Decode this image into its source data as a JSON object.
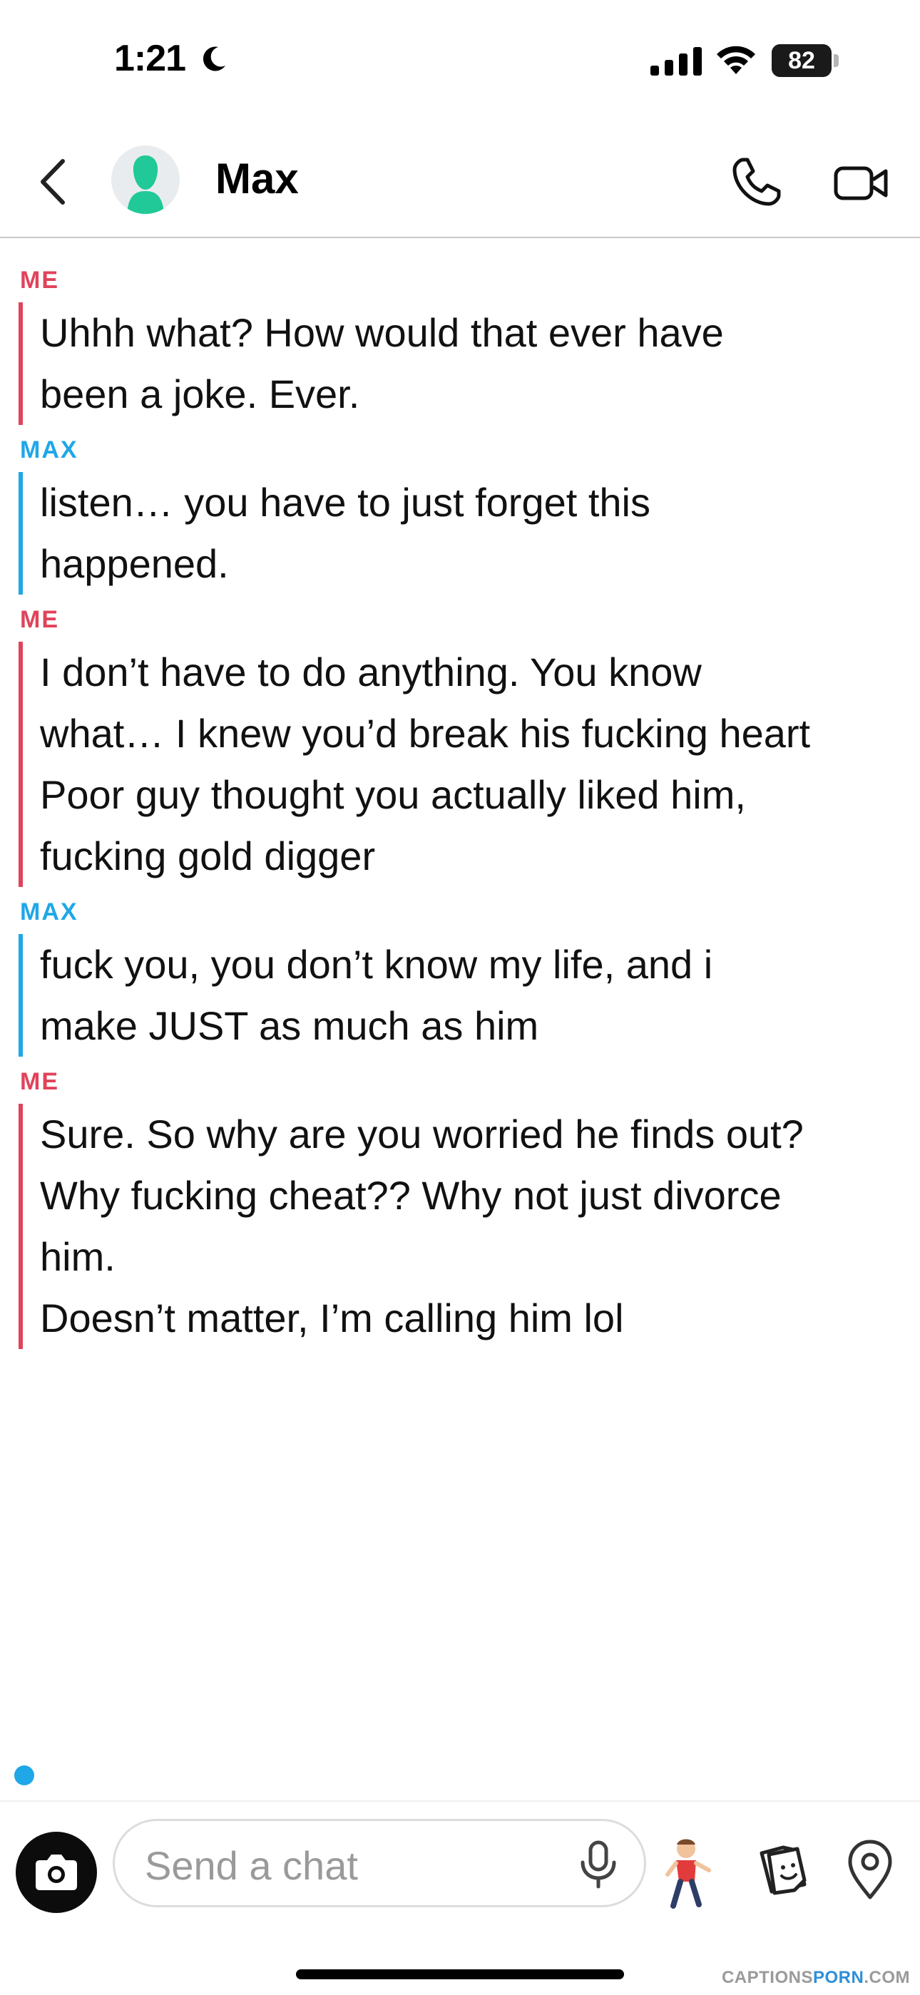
{
  "status_bar": {
    "time": "1:21",
    "battery": "82",
    "battery_level": 0.82
  },
  "header": {
    "contact_name": "Max"
  },
  "messages": [
    {
      "sender": "ME",
      "lines": [
        "Uhhh what? How would that ever have",
        "been a joke. Ever."
      ]
    },
    {
      "sender": "MAX",
      "lines": [
        "listen… you have to just forget this",
        "happened."
      ]
    },
    {
      "sender": "ME",
      "lines": [
        "I don’t have to do anything. You know",
        "what… I knew you’d break his fucking heart",
        "Poor guy thought you actually liked him,",
        "fucking gold digger"
      ]
    },
    {
      "sender": "MAX",
      "lines": [
        "fuck you, you don’t know my life, and i",
        "make JUST as much as him"
      ]
    },
    {
      "sender": "ME",
      "lines": [
        "Sure. So why are you worried he finds out?",
        "Why fucking cheat?? Why not just divorce",
        "him.",
        "Doesn’t matter, I’m calling him lol"
      ]
    }
  ],
  "composer": {
    "placeholder": "Send a chat"
  },
  "watermark": {
    "part1": "CAPTIONS",
    "part2": "PORN",
    "part3": ".COM"
  },
  "colors": {
    "me": "#e0435a",
    "max": "#1fa7e8",
    "avatar": "#20c997"
  },
  "icons": [
    "moon-icon",
    "signal-icon",
    "wifi-icon",
    "battery-icon",
    "back-chevron-icon",
    "avatar-icon",
    "phone-icon",
    "video-camera-icon",
    "camera-icon",
    "microphone-icon",
    "bitmoji-icon",
    "sticker-icon",
    "location-pin-icon"
  ]
}
